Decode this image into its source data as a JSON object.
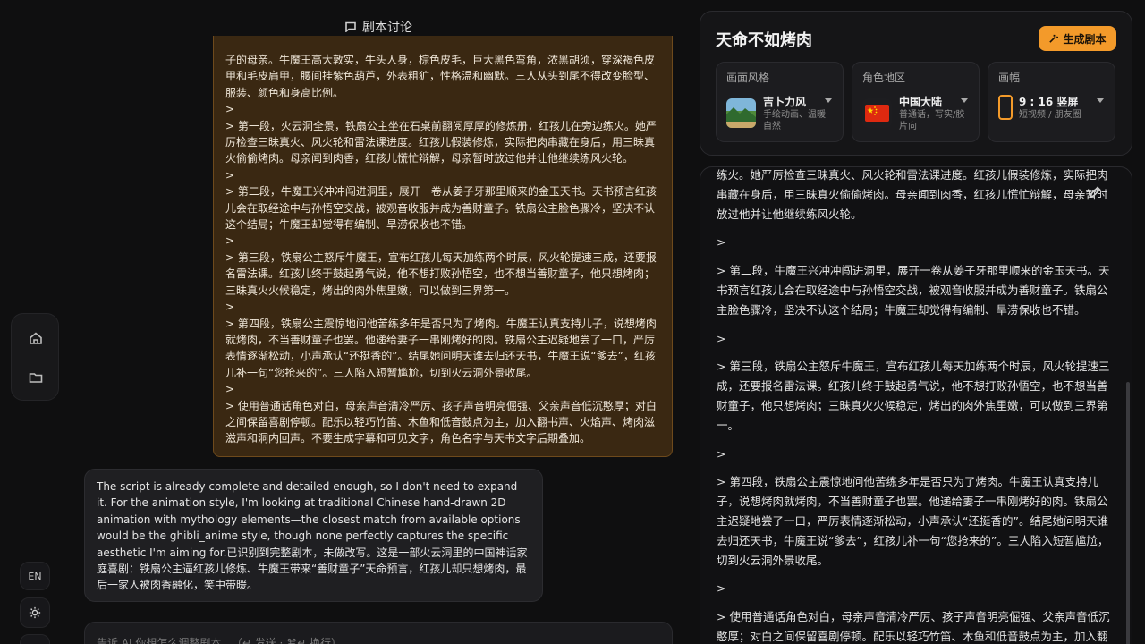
{
  "chat": {
    "title": "剧本讨论",
    "user_message": [
      "子的母亲。牛魔王高大敦实，牛头人身，棕色皮毛，巨大黑色弯角，浓黑胡须，穿深褐色皮甲和毛皮肩甲，腰间挂紫色葫芦，外表粗犷，性格温和幽默。三人从头到尾不得改变脸型、服装、颜色和身高比例。",
      ">",
      "> 第一段，火云洞全景，铁扇公主坐在石桌前翻阅厚厚的修炼册，红孩儿在旁边练火。她严厉检查三昧真火、风火轮和雷法课进度。红孩儿假装修炼，实际把肉串藏在身后，用三昧真火偷偷烤肉。母亲闻到肉香，红孩儿慌忙辩解，母亲暂时放过他并让他继续练风火轮。",
      ">",
      "> 第二段，牛魔王兴冲冲闯进洞里，展开一卷从姜子牙那里顺来的金玉天书。天书预言红孩儿会在取经途中与孙悟空交战，被观音收服并成为善财童子。铁扇公主脸色骤冷，坚决不认这个结局；牛魔王却觉得有编制、旱涝保收也不错。",
      ">",
      "> 第三段，铁扇公主怒斥牛魔王，宣布红孩儿每天加练两个时辰，风火轮提速三成，还要报名雷法课。红孩儿终于鼓起勇气说，他不想打败孙悟空，也不想当善财童子，他只想烤肉；三昧真火火候稳定，烤出的肉外焦里嫩，可以做到三界第一。",
      ">",
      "> 第四段，铁扇公主震惊地问他苦练多年是否只为了烤肉。牛魔王认真支持儿子，说想烤肉就烤肉，不当善财童子也罢。他递给妻子一串刚烤好的肉。铁扇公主迟疑地尝了一口，严厉表情逐渐松动，小声承认“还挺香的”。结尾她问明天谁去归还天书，牛魔王说“爹去”，红孩儿补一句“您抢来的”。三人陷入短暂尴尬，切到火云洞外景收尾。",
      ">",
      "> 使用普通话角色对白，母亲声音清冷严厉、孩子声音明亮倔强、父亲声音低沉憨厚；对白之间保留喜剧停顿。配乐以轻巧竹笛、木鱼和低音鼓点为主，加入翻书声、火焰声、烤肉滋滋声和洞内回声。不要生成字幕和可见文字，角色名字与天书文字后期叠加。"
    ],
    "ai_message": "The script is already complete and detailed enough, so I don't need to expand it. For the animation style, I'm looking at traditional Chinese hand-drawn 2D animation with mythology elements—the closest match from available options would be the ghibli_anime style, though none perfectly captures the specific aesthetic I'm aiming for.已识别到完整剧本，未做改写。这是一部火云洞里的中国神话家庭喜剧：铁扇公主逼红孩儿修炼、牛魔王带来“善财童子”天命预言，红孩儿却只想烤肉，最后一家人被肉香融化，笑中带暖。",
    "input_placeholder": "告诉 AI 你想怎么调整剧本...（↵ 发送 · ⌘↵ 换行）"
  },
  "sidebar": {
    "lang_label": "EN"
  },
  "script": {
    "title": "天命不如烤肉",
    "generate_label": "生成剧本",
    "options": [
      {
        "label": "画面风格",
        "name": "吉卜力风",
        "desc": "手绘动画、温暖自然",
        "icon": "landscape-thumbnail"
      },
      {
        "label": "角色地区",
        "name": "中国大陆",
        "desc": "普通话，写实/胶片向",
        "icon": "china-flag"
      },
      {
        "label": "画幅",
        "name": "9 : 16 竖屏",
        "desc": "短视频 / 朋友圈",
        "icon": "portrait-ratio-icon"
      }
    ],
    "paragraphs": [
      "练火。她严厉检查三昧真火、风火轮和雷法课进度。红孩儿假装修炼，实际把肉串藏在身后，用三昧真火偷偷烤肉。母亲闻到肉香，红孩儿慌忙辩解，母亲暂时放过他并让他继续练风火轮。",
      ">",
      "> 第二段，牛魔王兴冲冲闯进洞里，展开一卷从姜子牙那里顺来的金玉天书。天书预言红孩儿会在取经途中与孙悟空交战，被观音收服并成为善财童子。铁扇公主脸色骤冷，坚决不认这个结局；牛魔王却觉得有编制、旱涝保收也不错。",
      ">",
      "> 第三段，铁扇公主怒斥牛魔王，宣布红孩儿每天加练两个时辰，风火轮提速三成，还要报名雷法课。红孩儿终于鼓起勇气说，他不想打败孙悟空，也不想当善财童子，他只想烤肉；三昧真火火候稳定，烤出的肉外焦里嫩，可以做到三界第一。",
      ">",
      "> 第四段，铁扇公主震惊地问他苦练多年是否只为了烤肉。牛魔王认真支持儿子，说想烤肉就烤肉，不当善财童子也罢。他递给妻子一串刚烤好的肉。铁扇公主迟疑地尝了一口，严厉表情逐渐松动，小声承认“还挺香的”。结尾她问明天谁去归还天书，牛魔王说“爹去”，红孩儿补一句“您抢来的”。三人陷入短暂尴尬，切到火云洞外景收尾。",
      ">",
      "> 使用普通话角色对白，母亲声音清冷严厉、孩子声音明亮倔强、父亲声音低沉憨厚；对白之间保留喜剧停顿。配乐以轻巧竹笛、木鱼和低音鼓点为主，加入翻书声、火焰声、烤肉滋滋声和洞内回声。"
    ]
  },
  "colors": {
    "accent": "#f39a2a",
    "user_bubble_bg": "#3a2812",
    "user_bubble_border": "#6e4a1c",
    "background": "#0f0f10"
  }
}
